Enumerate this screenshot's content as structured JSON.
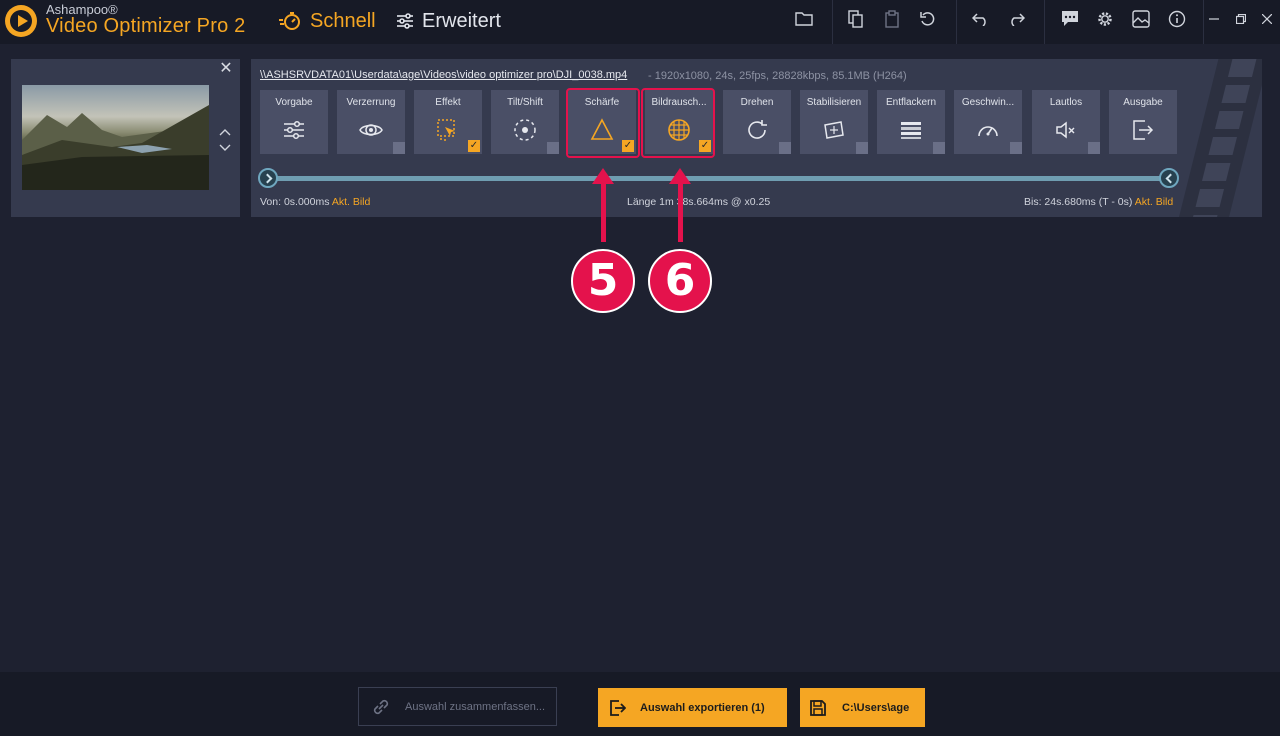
{
  "app": {
    "brand_top": "Ashampoo®",
    "brand_main": "Video Optimizer Pro 2"
  },
  "modes": [
    {
      "label": "Schnell",
      "active": true,
      "icon": "timer-icon"
    },
    {
      "label": "Erweitert",
      "active": false,
      "icon": "sliders-icon"
    }
  ],
  "toolbar_icons": [
    "folder-icon",
    "copy-icon",
    "paste-icon",
    "reset-icon",
    "undo-icon",
    "redo-icon",
    "feedback-icon",
    "gear-icon",
    "image-icon",
    "info-icon"
  ],
  "window_controls": [
    "minimize-icon",
    "restore-icon",
    "close-icon"
  ],
  "video": {
    "path": "\\\\ASHSRVDATA01\\Userdata\\age\\Videos\\video optimizer pro\\DJI_0038.mp4",
    "meta": "-  1920x1080, 24s, 25fps, 28828kbps, 85.1MB (H264)"
  },
  "tools": [
    {
      "label": "Vorgabe",
      "icon": "sliders-icon",
      "checked": false,
      "corner": false
    },
    {
      "label": "Verzerrung",
      "icon": "eye-icon",
      "checked": false,
      "corner": true
    },
    {
      "label": "Effekt",
      "icon": "effect-icon",
      "checked": true,
      "corner": false
    },
    {
      "label": "Tilt/Shift",
      "icon": "focus-icon",
      "checked": false,
      "corner": true
    },
    {
      "label": "Schärfe",
      "icon": "triangle-icon",
      "checked": true,
      "corner": false
    },
    {
      "label": "Bildrausch...",
      "icon": "noise-grid-icon",
      "checked": true,
      "corner": false
    },
    {
      "label": "Drehen",
      "icon": "rotate-icon",
      "checked": false,
      "corner": true
    },
    {
      "label": "Stabilisieren",
      "icon": "stabilize-icon",
      "checked": false,
      "corner": true
    },
    {
      "label": "Entflackern",
      "icon": "deflicker-icon",
      "checked": false,
      "corner": true
    },
    {
      "label": "Geschwin...",
      "icon": "speedometer-icon",
      "checked": false,
      "corner": true
    },
    {
      "label": "Lautlos",
      "icon": "mute-icon",
      "checked": false,
      "corner": true
    },
    {
      "label": "Ausgabe",
      "icon": "export-icon",
      "checked": false,
      "corner": false
    }
  ],
  "timeline": {
    "von_label": "Von: 0s.000ms",
    "von_link": "Akt. Bild",
    "laenge": "Länge  1m 38s.664ms @ x0.25",
    "bis_label": "Bis:  24s.680ms (T - 0s)",
    "bis_link": "Akt. Bild"
  },
  "annotations": [
    {
      "number": "5",
      "target": "Schärfe"
    },
    {
      "number": "6",
      "target": "Bildrausch..."
    }
  ],
  "bottom": {
    "merge_label": "Auswahl zusammenfassen...",
    "export_label": "Auswahl exportieren (1)",
    "path_label": "C:\\Users\\age"
  },
  "colors": {
    "accent": "#f5a623",
    "annotation": "#e4124c",
    "background": "#1e2130",
    "card": "#353a4e",
    "tile": "#4a4f66"
  }
}
